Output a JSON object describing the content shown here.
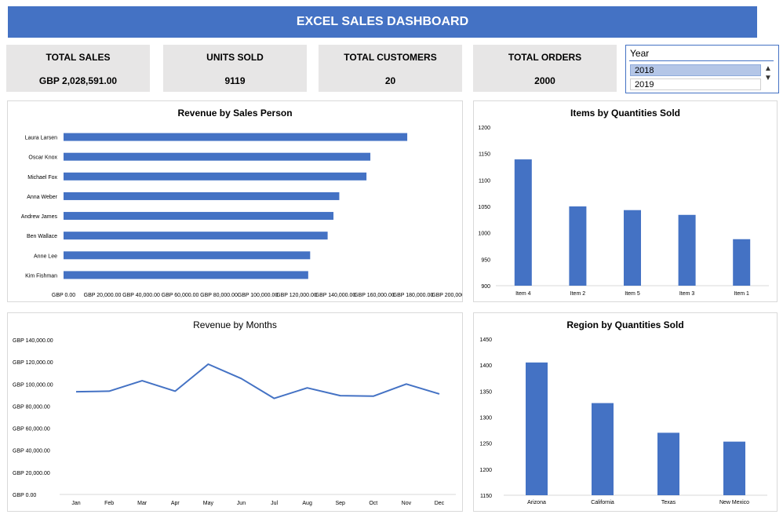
{
  "title": "EXCEL SALES DASHBOARD",
  "kpis": [
    {
      "label": "TOTAL SALES",
      "value": "GBP 2,028,591.00"
    },
    {
      "label": "UNITS SOLD",
      "value": "9119"
    },
    {
      "label": "TOTAL CUSTOMERS",
      "value": "20"
    },
    {
      "label": "TOTAL ORDERS",
      "value": "2000"
    }
  ],
  "slicer": {
    "header": "Year",
    "options": [
      {
        "label": "2018",
        "selected": true
      },
      {
        "label": "2019",
        "selected": false
      }
    ],
    "scroll_icons": [
      "chevron-up-icon",
      "chevron-down-icon"
    ]
  },
  "colors": {
    "accent": "#4472c4",
    "kpi_bg": "#e7e6e6",
    "slicer_selected": "#b4c6e7"
  },
  "chart_data": [
    {
      "id": "sales-person",
      "type": "bar",
      "orientation": "horizontal",
      "title": "Revenue by Sales Person",
      "categories": [
        "Laura Larsen",
        "Oscar Knox",
        "Michael Fox",
        "Anna Weber",
        "Andrew James",
        "Ben Wallace",
        "Anne Lee",
        "Kim Fishman"
      ],
      "values": [
        177000,
        158000,
        156000,
        142000,
        139000,
        136000,
        127000,
        126000
      ],
      "xlim": [
        0,
        200000
      ],
      "ticks": [
        "GBP 0.00",
        "GBP 20,000.00",
        "GBP 40,000.00",
        "GBP 60,000.00",
        "GBP 80,000.00",
        "GBP 100,000.00",
        "GBP 120,000.00",
        "GBP 140,000.00",
        "GBP 160,000.00",
        "GBP 180,000.00",
        "GBP 200,000.00"
      ],
      "color": "#4472c4"
    },
    {
      "id": "items",
      "type": "bar",
      "title": "Items by Quantities Sold",
      "categories": [
        "Item 4",
        "Item 2",
        "Item 5",
        "Item 3",
        "Item 1"
      ],
      "values": [
        1139,
        1050,
        1043,
        1034,
        988
      ],
      "ylim": [
        900,
        1200
      ],
      "ticks": [
        "900",
        "950",
        "1000",
        "1050",
        "1100",
        "1150",
        "1200"
      ],
      "color": "#4472c4"
    },
    {
      "id": "months",
      "type": "line",
      "title": "Revenue by Months",
      "categories": [
        "Jan",
        "Feb",
        "Mar",
        "Apr",
        "May",
        "Jun",
        "Jul",
        "Aug",
        "Sep",
        "Oct",
        "Nov",
        "Dec"
      ],
      "values": [
        93000,
        93500,
        103000,
        93500,
        118000,
        105000,
        87000,
        96500,
        89500,
        89000,
        100000,
        91000
      ],
      "ylim": [
        0,
        140000
      ],
      "ticks": [
        "GBP 0.00",
        "GBP 20,000.00",
        "GBP 40,000.00",
        "GBP 60,000.00",
        "GBP 80,000.00",
        "GBP 100,000.00",
        "GBP 120,000.00",
        "GBP 140,000.00"
      ],
      "color": "#4472c4"
    },
    {
      "id": "region",
      "type": "bar",
      "title": "Region by Quantities Sold",
      "categories": [
        "Arizona",
        "California",
        "Texas",
        "New Mexico"
      ],
      "values": [
        1405,
        1327,
        1270,
        1253
      ],
      "ylim": [
        1150,
        1450
      ],
      "ticks": [
        "1150",
        "1200",
        "1250",
        "1300",
        "1350",
        "1400",
        "1450"
      ],
      "color": "#4472c4"
    }
  ]
}
